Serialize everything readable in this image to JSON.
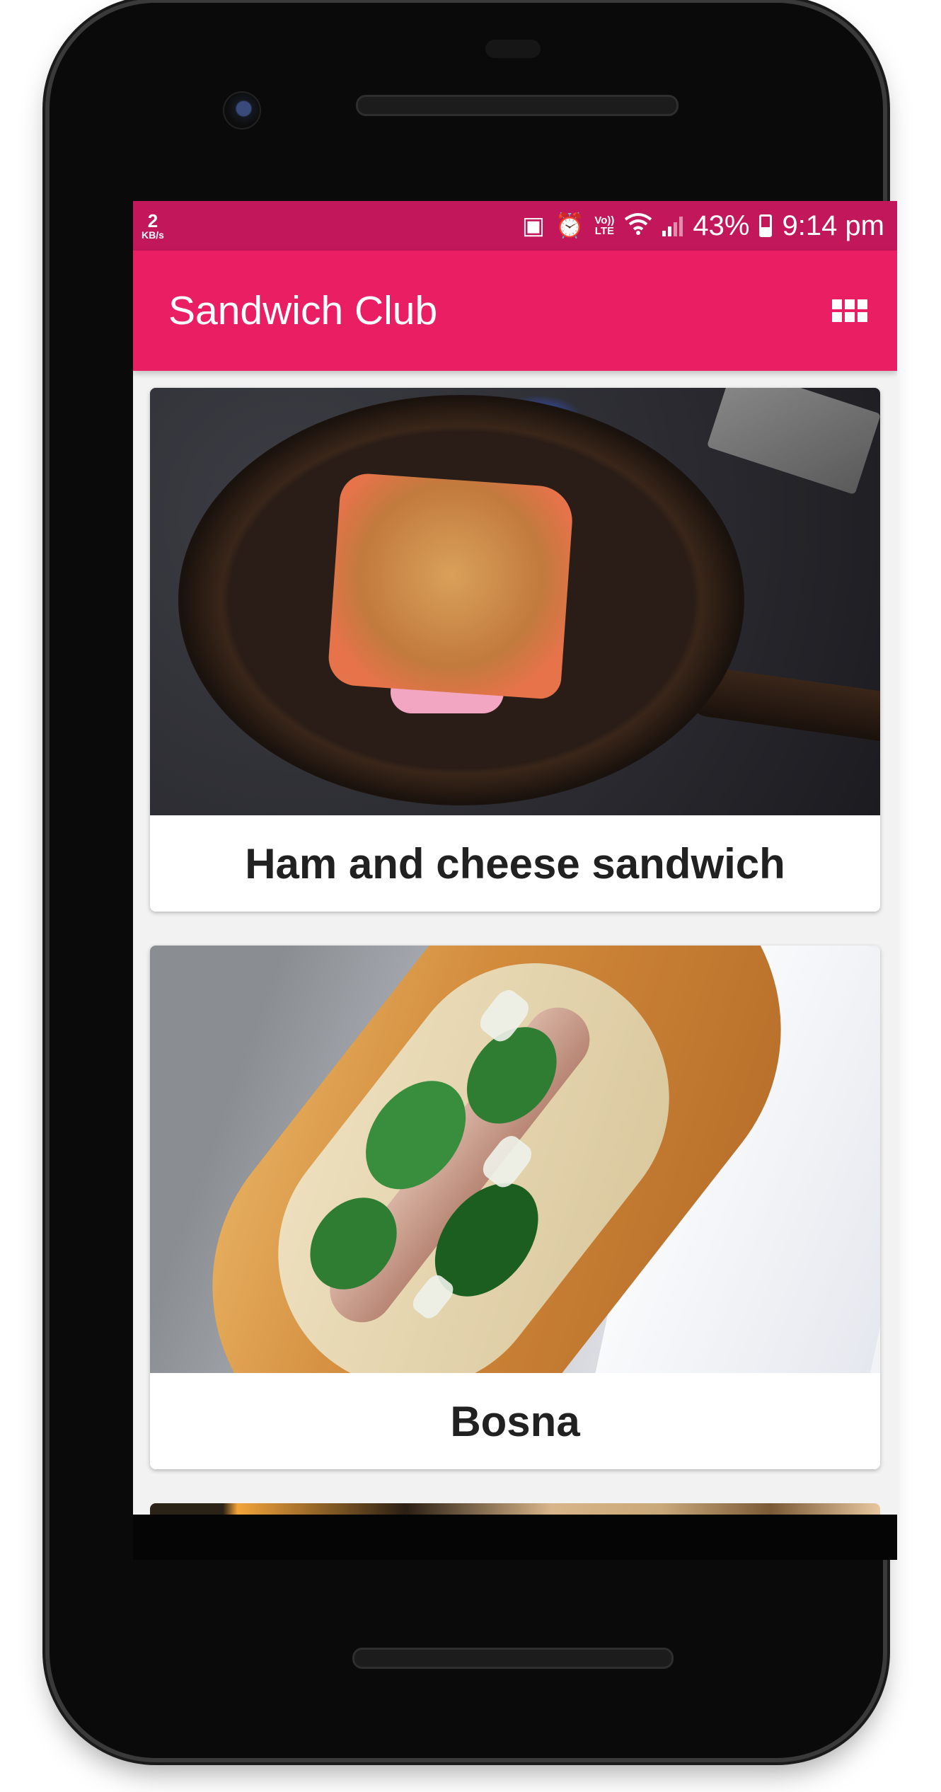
{
  "status_bar": {
    "net_speed_value": "2",
    "net_speed_unit": "KB/s",
    "volte_label": "Vo))",
    "lte_label": "LTE",
    "battery_percent": "43%",
    "time": "9:14 pm"
  },
  "app_bar": {
    "title": "Sandwich Club",
    "layout_icon": "grid-view-icon"
  },
  "sandwiches": [
    {
      "name": "Ham and cheese sandwich"
    },
    {
      "name": "Bosna"
    }
  ],
  "colors": {
    "primary": "#e91e63",
    "primary_dark": "#c2185b"
  }
}
